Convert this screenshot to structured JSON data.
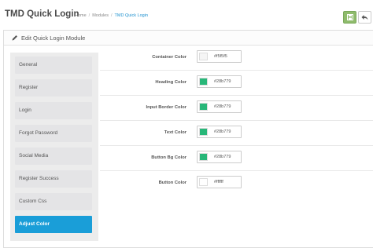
{
  "header": {
    "title": "TMD Quick Login",
    "breadcrumb": [
      "Home",
      "Modules",
      "TMD Quick Login"
    ],
    "save_icon": "save-icon",
    "back_icon": "reply-icon"
  },
  "panel": {
    "title": "Edit Quick Login Module",
    "icon": "pencil-icon"
  },
  "sidebar": {
    "items": [
      {
        "label": "General"
      },
      {
        "label": "Register"
      },
      {
        "label": "Login"
      },
      {
        "label": "Forgot Password"
      },
      {
        "label": "Social Media"
      },
      {
        "label": "Register Success"
      },
      {
        "label": "Custom Css"
      },
      {
        "label": "Adjust Color"
      }
    ],
    "active_index": 7
  },
  "colors": {
    "rows": [
      {
        "label": "Container Color",
        "value": "#f5f5f5",
        "swatch": "#f5f5f5"
      },
      {
        "label": "Heading Color",
        "value": "#28b779",
        "swatch": "#28b779"
      },
      {
        "label": "Input Border Color",
        "value": "#28b779",
        "swatch": "#28b779"
      },
      {
        "label": "Text Color",
        "value": "#28b779",
        "swatch": "#28b779"
      },
      {
        "label": "Button Bg Color",
        "value": "#28b779",
        "swatch": "#28b779"
      },
      {
        "label": "Button Color",
        "value": "#ffffff",
        "swatch": "#ffffff"
      }
    ]
  },
  "theme": {
    "accent": "#1a9ed8",
    "save_button": "#8fbb6c",
    "breadcrumb_active": "#1e91cf"
  }
}
